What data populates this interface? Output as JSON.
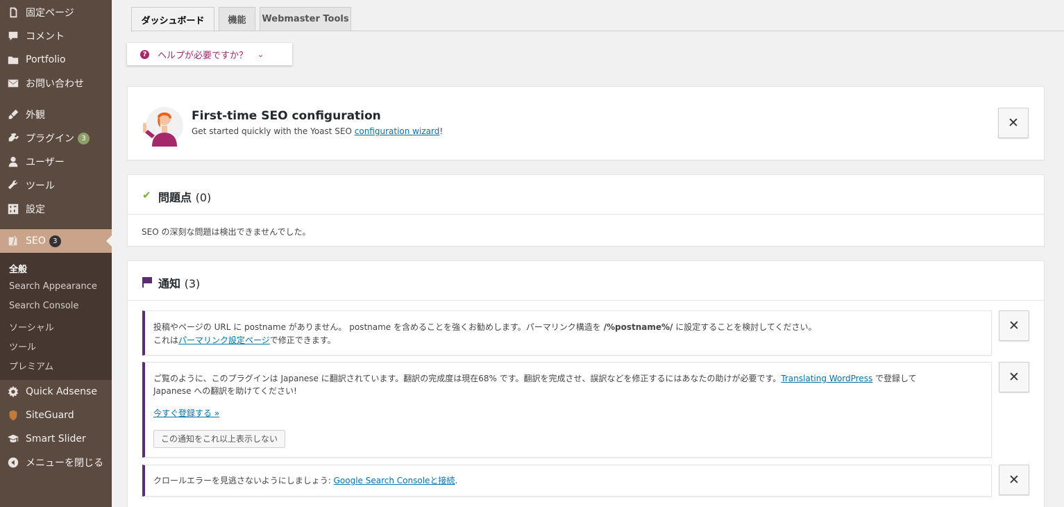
{
  "sidebar": {
    "items": [
      {
        "label": "固定ページ",
        "icon": "page-icon"
      },
      {
        "label": "コメント",
        "icon": "comment-icon"
      },
      {
        "label": "Portfolio",
        "icon": "folder-icon"
      },
      {
        "label": "お問い合わせ",
        "icon": "mail-icon"
      },
      {
        "label": "外観",
        "icon": "brush-icon"
      },
      {
        "label": "プラグイン",
        "icon": "plugin-icon",
        "badge": "3"
      },
      {
        "label": "ユーザー",
        "icon": "user-icon"
      },
      {
        "label": "ツール",
        "icon": "wrench-icon"
      },
      {
        "label": "設定",
        "icon": "settings-icon"
      },
      {
        "label": "SEO",
        "icon": "yoast-icon",
        "badge": "3",
        "active": true
      },
      {
        "label": "Quick Adsense",
        "icon": "gear-icon"
      },
      {
        "label": "SiteGuard",
        "icon": "shield-icon"
      },
      {
        "label": "Smart Slider",
        "icon": "cap-icon"
      },
      {
        "label": "メニューを閉じる",
        "icon": "collapse-icon"
      }
    ],
    "submenu": [
      "全般",
      "Search Appearance",
      "Search Console",
      "ソーシャル",
      "ツール",
      "プレミアム"
    ]
  },
  "tabs": [
    "ダッシュボード",
    "機能",
    "Webmaster Tools"
  ],
  "help": {
    "label": "ヘルプが必要ですか？"
  },
  "config": {
    "title": "First-time SEO configuration",
    "desc_prefix": "Get started quickly with the Yoast SEO ",
    "link": "configuration wizard",
    "desc_suffix": "!"
  },
  "problems": {
    "title": "問題点",
    "count": "(0)",
    "message": "SEO の深刻な問題は検出できませんでした。"
  },
  "notifications": {
    "title": "通知",
    "count": "(3)",
    "n1": {
      "l1_a": "投稿やページの URL に postname がありません。 postname を含めることを強くお勧めします。パーマリンク構造を ",
      "l1_b": "/%postname%/",
      "l1_c": " に設定することを検討してください。",
      "l2_a": "これは",
      "l2_link": "パーマリンク設定ページ",
      "l2_b": "で修正できます。"
    },
    "n2": {
      "l1_a": "ご覧のように、このプラグインは Japanese に翻訳されています。翻訳の完成度は現在68% です。翻訳を完成させ、誤訳などを修正するにはあなたの助けが必要です。",
      "l1_link": "Translating WordPress",
      "l1_b": " で登録して",
      "l2": "Japanese への翻訳を助けてください!",
      "register": "今すぐ登録する »",
      "dismiss": "この通知をこれ以上表示しない"
    },
    "n3": {
      "text": "クロールエラーを見逃さないようにしましょう: ",
      "link": "Google Search Consoleと接続",
      "suffix": "."
    }
  },
  "close_symbol": "✕",
  "colors": {
    "sidebar_bg": "#5b4a40",
    "sidebar_active": "#caa48a",
    "yoast_purple": "#a4286a",
    "notice_border": "#5b2c6f",
    "check_green": "#77b227"
  }
}
